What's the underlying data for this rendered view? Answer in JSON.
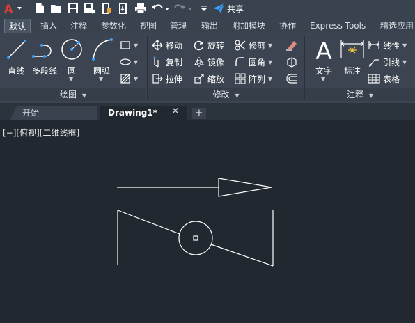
{
  "qat": {
    "share_label": "共享"
  },
  "tabs": [
    {
      "label": "默认"
    },
    {
      "label": "插入"
    },
    {
      "label": "注释"
    },
    {
      "label": "参数化"
    },
    {
      "label": "视图"
    },
    {
      "label": "管理"
    },
    {
      "label": "输出"
    },
    {
      "label": "附加模块"
    },
    {
      "label": "协作"
    },
    {
      "label": "Express Tools"
    },
    {
      "label": "精选应用"
    }
  ],
  "ribbon": {
    "draw": {
      "title": "绘图",
      "line": "直线",
      "polyline": "多段线",
      "circle": "圆",
      "arc": "圆弧"
    },
    "modify": {
      "title": "修改",
      "move": "移动",
      "rotate": "旋转",
      "trim": "修剪",
      "copy": "复制",
      "mirror": "镜像",
      "fillet": "圆角",
      "stretch": "拉伸",
      "scale": "缩放",
      "array": "阵列"
    },
    "annotation": {
      "title": "注释",
      "text": "文字",
      "dimension": "标注",
      "linear": "线性",
      "leader": "引线",
      "table": "表格"
    }
  },
  "file_tabs": {
    "start": "开始",
    "drawing": "Drawing1*",
    "close": "✕",
    "add": "+"
  },
  "viewport": {
    "label": "[−][俯视][二维线框]"
  },
  "colors": {
    "app_red": "#e03c31",
    "share_blue": "#3aa0ff",
    "canvas_bg": "#212830",
    "geometry": "#ffffff"
  }
}
